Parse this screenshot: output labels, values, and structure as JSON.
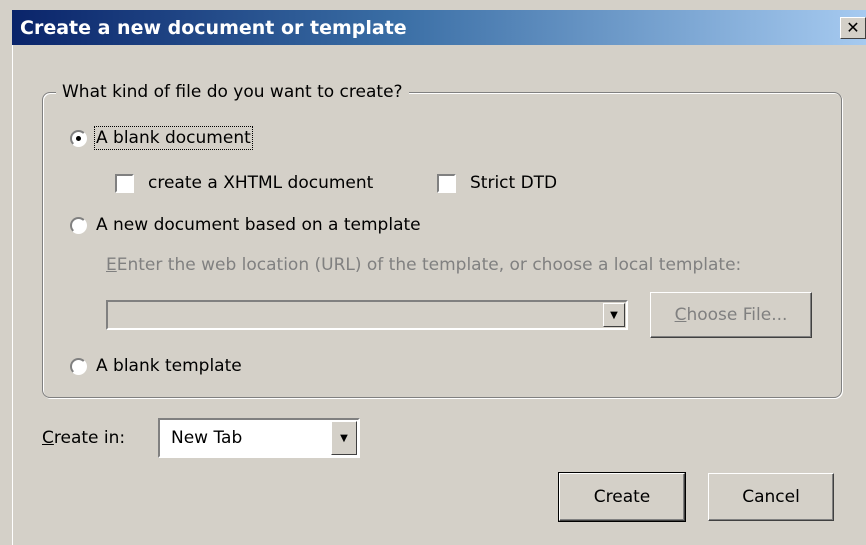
{
  "dialog": {
    "title": "Create a new document or template",
    "close_glyph": "✕"
  },
  "group": {
    "legend": "What kind of file do you want to create?",
    "blank_document": {
      "label": "A blank document",
      "selected": true
    },
    "xhtml_checkbox": {
      "label": "create a XHTML document",
      "checked": false
    },
    "strict_dtd_checkbox": {
      "label": "Strict DTD",
      "checked": false
    },
    "template_document": {
      "label": "A new document based on a template",
      "selected": false
    },
    "template_hint": "Enter the web location (URL) of the template, or choose a local template:",
    "template_url": {
      "value": ""
    },
    "choose_file_button": {
      "label_prefix": "C",
      "label_rest": "hoose File..."
    },
    "blank_template": {
      "label": "A blank template",
      "selected": false
    }
  },
  "create_in": {
    "label_prefix": "C",
    "label_rest": "reate in:",
    "selected": "New Tab"
  },
  "buttons": {
    "create": "Create",
    "cancel": "Cancel"
  }
}
